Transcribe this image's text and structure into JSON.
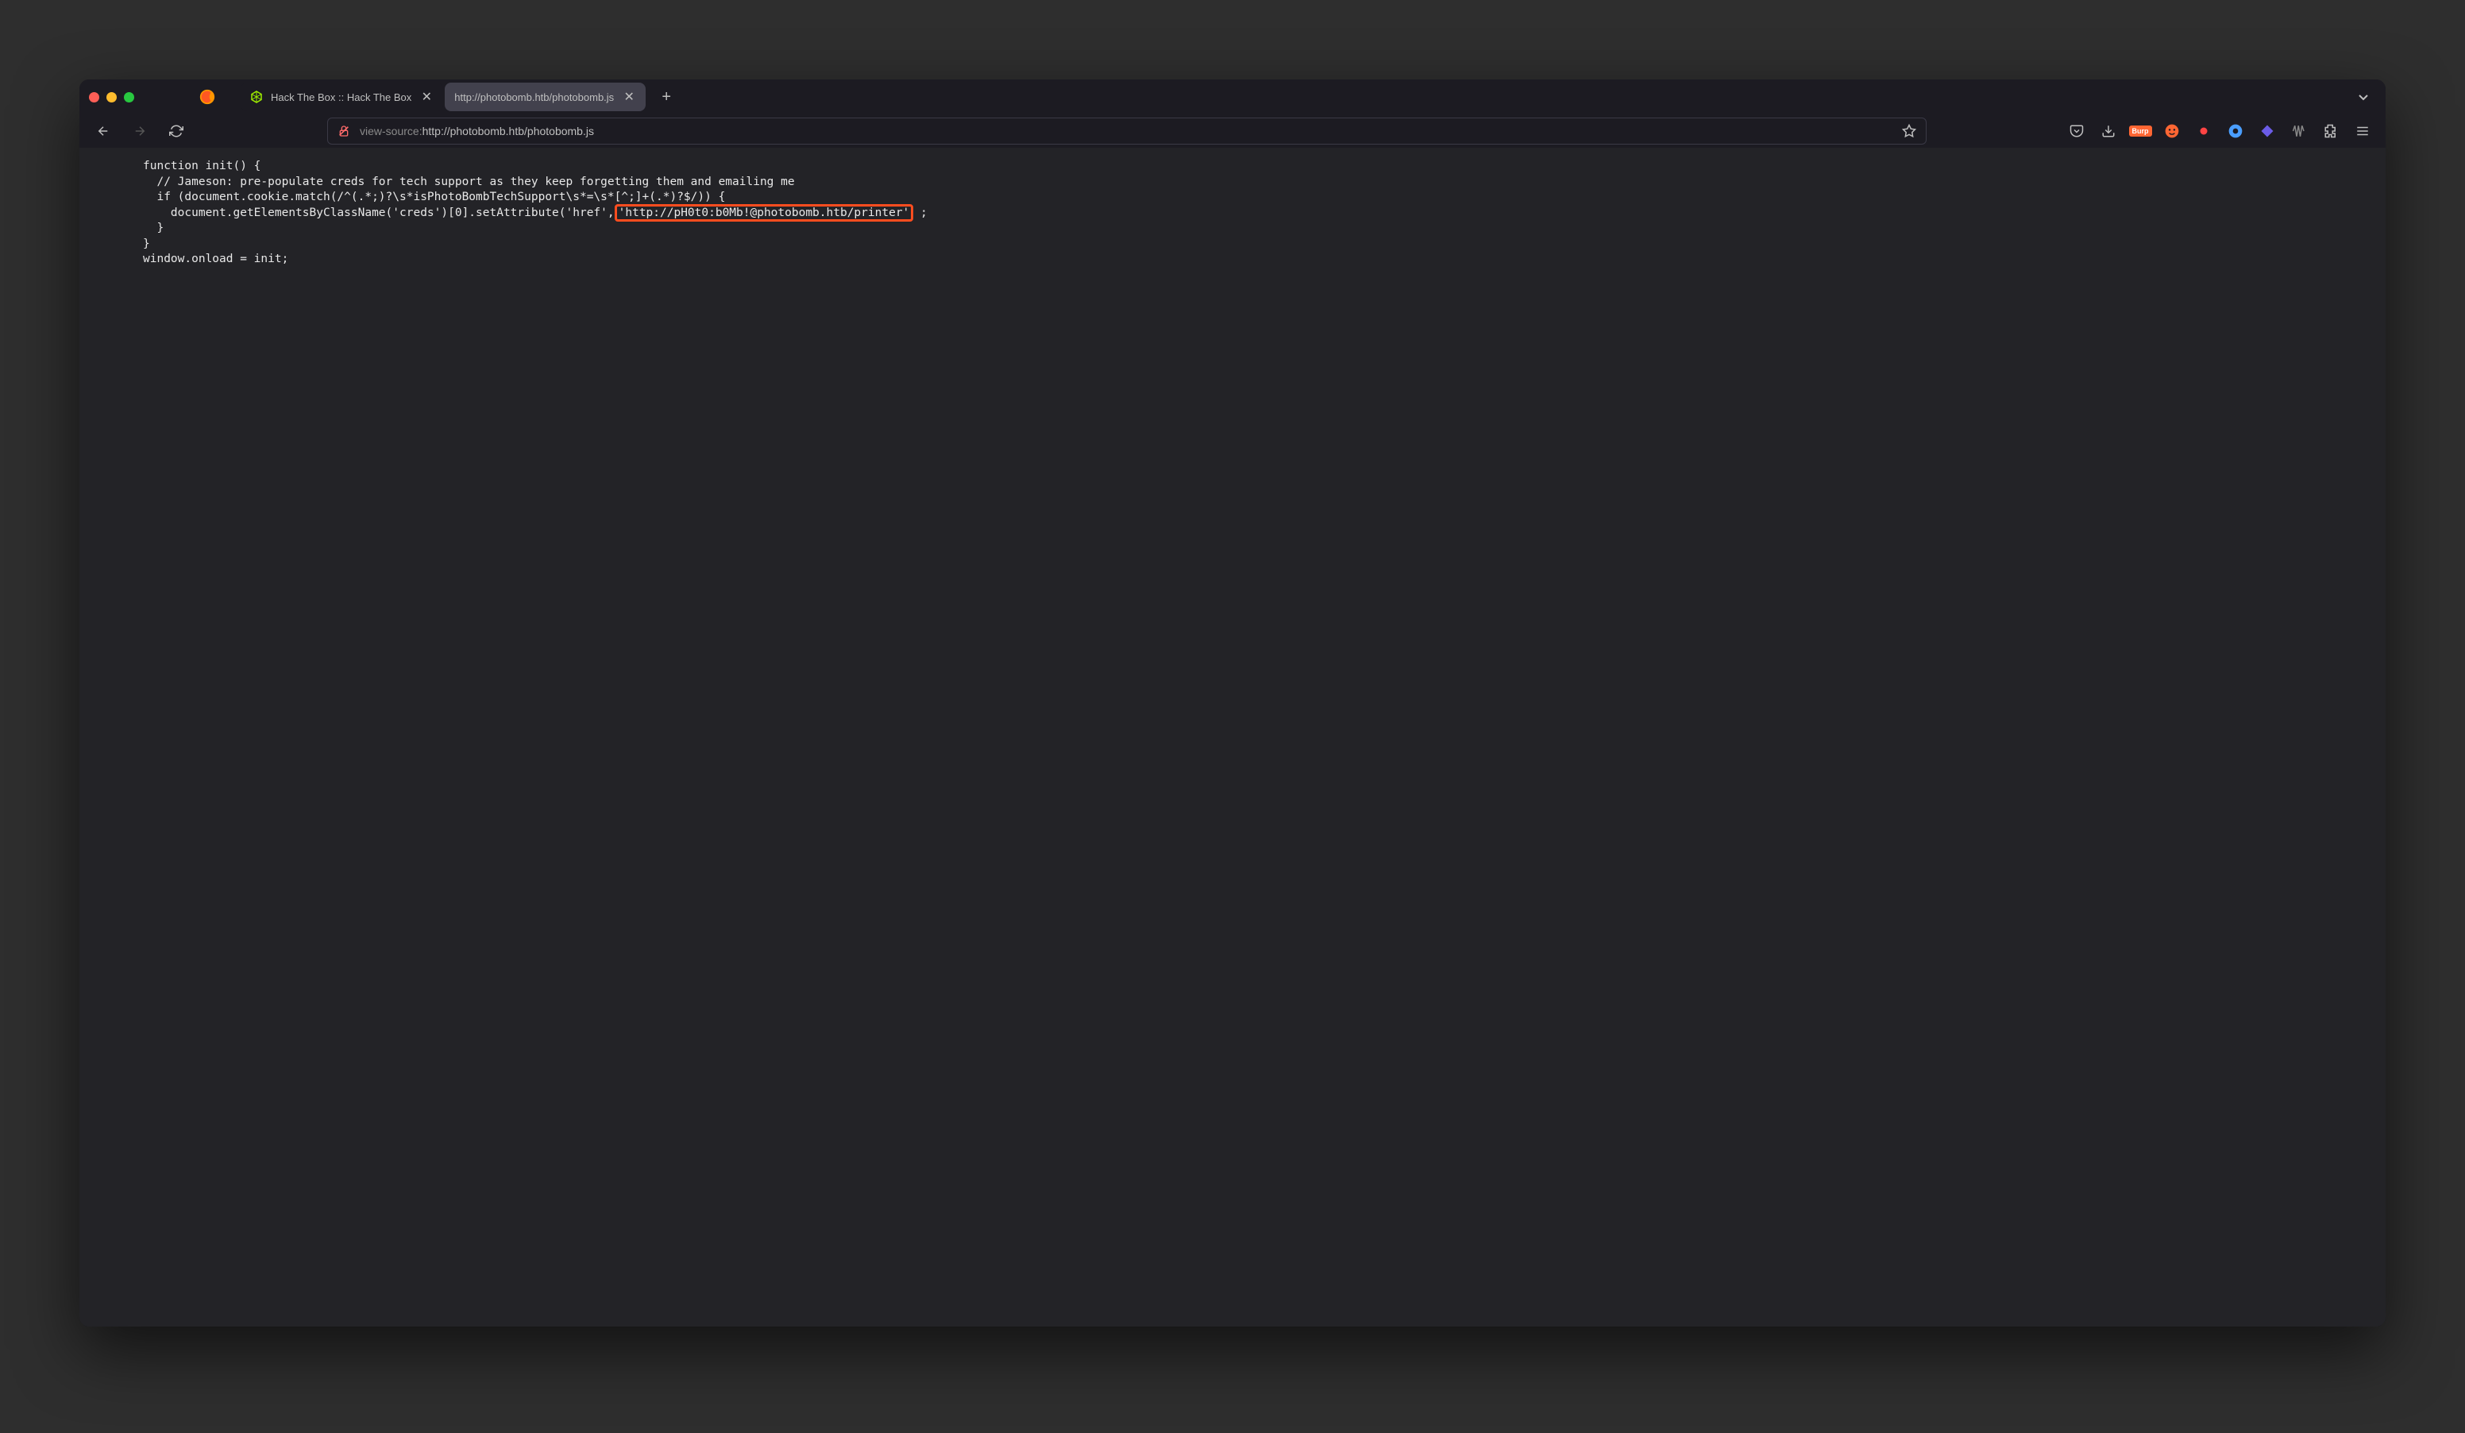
{
  "tabs": [
    {
      "title": "Hack The Box :: Hack The Box"
    },
    {
      "title": "http://photobomb.htb/photobomb.js"
    }
  ],
  "url": {
    "protocol": "view-source:",
    "rest": "http://photobomb.htb/photobomb.js"
  },
  "code": {
    "line1": "function init() {",
    "line2": "  // Jameson: pre-populate creds for tech support as they keep forgetting them and emailing me",
    "line3": "  if (document.cookie.match(/^(.*;)?\\s*isPhotoBombTechSupport\\s*=\\s*[^;]+(.*)?$/)) {",
    "line4a": "    document.getElementsByClassName('creds')[0].setAttribute('href',",
    "line4_highlight": "'http://pH0t0:b0Mb!@photobomb.htb/printer'",
    "line4b": ";",
    "line5": "  }",
    "line6": "}",
    "line7": "window.onload = init;"
  },
  "toolbar": {
    "burp_label": "Burp"
  }
}
